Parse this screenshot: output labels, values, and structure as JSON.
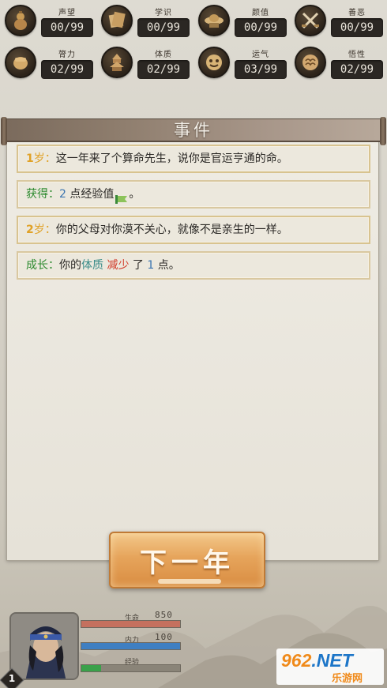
{
  "stats": [
    {
      "name": "声望",
      "value": "00/99",
      "icon": "gourd-icon"
    },
    {
      "name": "学识",
      "value": "00/99",
      "icon": "scroll-icon"
    },
    {
      "name": "颜值",
      "value": "00/99",
      "icon": "straw-hat-icon"
    },
    {
      "name": "善恶",
      "value": "00/99",
      "icon": "crossed-swords-icon"
    },
    {
      "name": "膂力",
      "value": "02/99",
      "icon": "fist-icon"
    },
    {
      "name": "体质",
      "value": "02/99",
      "icon": "pagoda-icon"
    },
    {
      "name": "运气",
      "value": "03/99",
      "icon": "fortune-face-icon"
    },
    {
      "name": "悟性",
      "value": "02/99",
      "icon": "brain-icon"
    }
  ],
  "panel": {
    "title": "事件"
  },
  "events": [
    {
      "age": "1",
      "age_unit": "岁：",
      "text": "这一年来了个算命先生，说你是官运亨通的命。"
    },
    {
      "gain_label": "获得：",
      "gain_amount": "2",
      "gain_text": " 点经验值",
      "gain_end": "。"
    },
    {
      "age": "2",
      "age_unit": "岁：",
      "text": "你的父母对你漠不关心，就像不是亲生的一样。"
    },
    {
      "grow_label": "成长：",
      "grow_pre": "你的",
      "grow_attr": "体质",
      "grow_dir": "减少",
      "grow_mid": " 了 ",
      "grow_amount": "1",
      "grow_end": " 点。"
    }
  ],
  "next_button": {
    "label": "下一年"
  },
  "character": {
    "level": "1",
    "hp_label": "生命",
    "hp_value": "850",
    "hp_fill": 1.0,
    "mp_label": "内力",
    "mp_value": "100",
    "mp_fill": 1.0,
    "xp_label": "经验",
    "xp_fill": 0.2
  },
  "watermark": {
    "brand": "962",
    "brand_net": ".NET",
    "sub": "乐游网"
  },
  "colors": {
    "hp_bar": "#c4705e",
    "mp_bar": "#3f7fc2",
    "xp_bar": "#3aa14a",
    "age_gold": "#e0a126",
    "button": "#e6a45b"
  }
}
